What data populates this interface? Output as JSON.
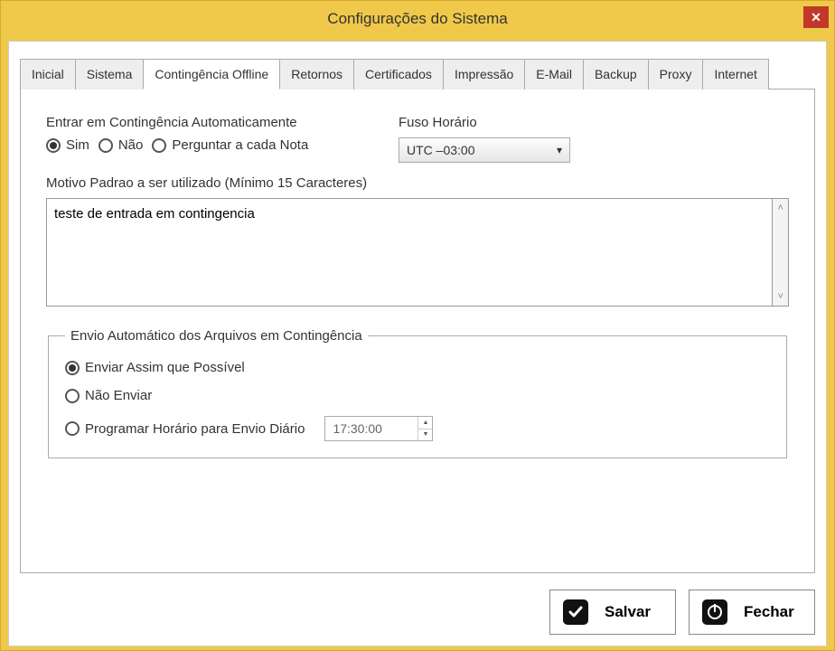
{
  "window": {
    "title": "Configurações do Sistema"
  },
  "tabs": {
    "t0": "Inicial",
    "t1": "Sistema",
    "t2": "Contingência Offline",
    "t3": "Retornos",
    "t4": "Certificados",
    "t5": "Impressão",
    "t6": "E-Mail",
    "t7": "Backup",
    "t8": "Proxy",
    "t9": "Internet"
  },
  "contingency": {
    "auto_label": "Entrar em Contingência Automaticamente",
    "timezone_label": "Fuso Horário",
    "radio_sim": "Sim",
    "radio_nao": "Não",
    "radio_ask": "Perguntar a cada Nota",
    "timezone_value": "UTC –03:00",
    "motivo_label": "Motivo Padrao a ser utilizado (Mínimo 15 Caracteres)",
    "motivo_value": "teste de entrada em contingencia"
  },
  "envio": {
    "legend": "Envio Automático dos Arquivos em Contingência",
    "opt_asap": "Enviar Assim que Possível",
    "opt_never": "Não Enviar",
    "opt_schedule": "Programar Horário para Envio Diário",
    "time_value": "17:30:00"
  },
  "footer": {
    "save": "Salvar",
    "close": "Fechar"
  }
}
